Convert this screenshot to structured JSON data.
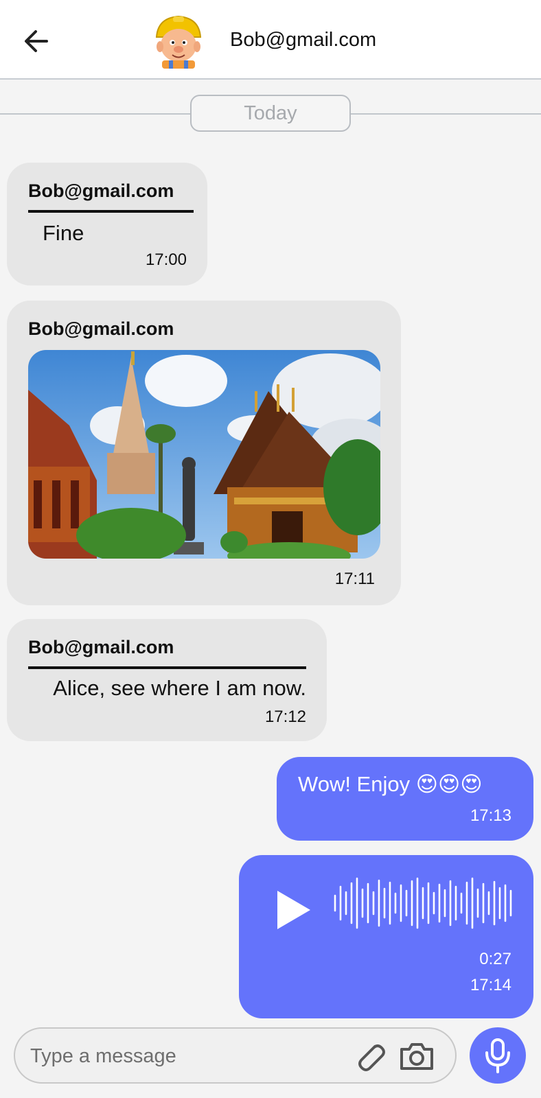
{
  "header": {
    "contact": "Bob@gmail.com"
  },
  "divider": {
    "date_label": "Today"
  },
  "messages": [
    {
      "direction": "incoming",
      "sender": "Bob@gmail.com",
      "text": "Fine",
      "time": "17:00"
    },
    {
      "direction": "incoming",
      "sender": "Bob@gmail.com",
      "type": "image",
      "image_alt": "Temples",
      "time": "17:11"
    },
    {
      "direction": "incoming",
      "sender": "Bob@gmail.com",
      "text": "Alice, see where I am now.",
      "time": "17:12"
    },
    {
      "direction": "outgoing",
      "text": "Wow! Enjoy 😍😍😍",
      "time": "17:13"
    },
    {
      "direction": "outgoing",
      "type": "voice",
      "duration": "0:27",
      "time": "17:14"
    }
  ],
  "composer": {
    "placeholder": "Type a message"
  },
  "icons": {
    "back": "arrow-left-icon",
    "attach": "paperclip-icon",
    "camera": "camera-icon",
    "mic": "microphone-icon",
    "play": "play-icon"
  },
  "colors": {
    "outgoing_bubble": "#6473fb",
    "incoming_bubble": "#e6e6e6",
    "background": "#f4f4f4"
  }
}
